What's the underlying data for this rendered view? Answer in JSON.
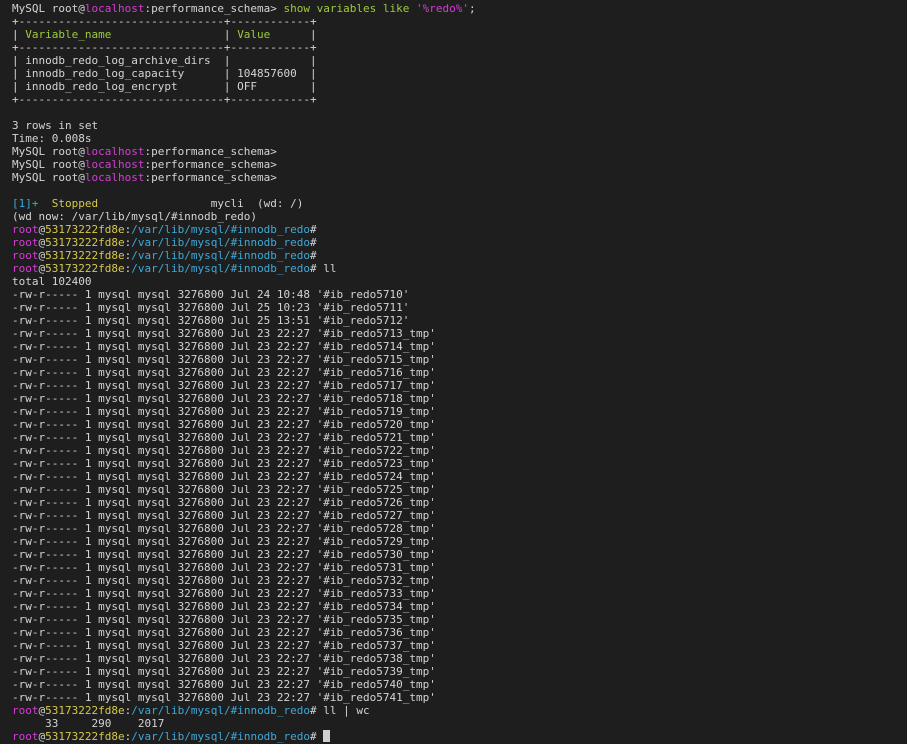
{
  "lines": [
    [
      {
        "t": "MySQL root@",
        "c": "wht"
      },
      {
        "t": "localhost",
        "c": "mag"
      },
      {
        "t": ":performance_schema> ",
        "c": "wht"
      },
      {
        "t": "show variables like ",
        "c": "grn"
      },
      {
        "t": "'%redo%'",
        "c": "mag"
      },
      {
        "t": ";",
        "c": "wht"
      }
    ],
    [
      {
        "t": "+-------------------------------+------------+",
        "c": "wht"
      }
    ],
    [
      {
        "t": "| ",
        "c": "wht"
      },
      {
        "t": "Variable_name",
        "c": "grn"
      },
      {
        "t": "                 | ",
        "c": "wht"
      },
      {
        "t": "Value",
        "c": "grn"
      },
      {
        "t": "      |",
        "c": "wht"
      }
    ],
    [
      {
        "t": "+-------------------------------+------------+",
        "c": "wht"
      }
    ],
    [
      {
        "t": "| innodb_redo_log_archive_dirs  |            |",
        "c": "wht"
      }
    ],
    [
      {
        "t": "| innodb_redo_log_capacity      | 104857600  |",
        "c": "wht"
      }
    ],
    [
      {
        "t": "| innodb_redo_log_encrypt       | OFF        |",
        "c": "wht"
      }
    ],
    [
      {
        "t": "+-------------------------------+------------+",
        "c": "wht"
      }
    ],
    [],
    [
      {
        "t": "3 rows in set",
        "c": "wht"
      }
    ],
    [
      {
        "t": "Time: 0.008s",
        "c": "wht"
      }
    ],
    [
      {
        "t": "MySQL root@",
        "c": "wht"
      },
      {
        "t": "localhost",
        "c": "mag"
      },
      {
        "t": ":performance_schema>",
        "c": "wht"
      }
    ],
    [
      {
        "t": "MySQL root@",
        "c": "wht"
      },
      {
        "t": "localhost",
        "c": "mag"
      },
      {
        "t": ":performance_schema>",
        "c": "wht"
      }
    ],
    [
      {
        "t": "MySQL root@",
        "c": "wht"
      },
      {
        "t": "localhost",
        "c": "mag"
      },
      {
        "t": ":performance_schema>",
        "c": "wht"
      }
    ],
    [],
    [
      {
        "t": "[1]+  ",
        "c": "cyn"
      },
      {
        "t": "Stopped",
        "c": "ylw"
      },
      {
        "t": "                 mycli  (wd: /)",
        "c": "wht"
      }
    ],
    [
      {
        "t": "(wd now: /var/lib/mysql/#innodb_redo)",
        "c": "wht"
      }
    ],
    [
      {
        "t": "root",
        "c": "mag"
      },
      {
        "t": "@",
        "c": "wht"
      },
      {
        "t": "53173222fd8e",
        "c": "ylw"
      },
      {
        "t": ":",
        "c": "wht"
      },
      {
        "t": "/var/lib/mysql/#innodb_redo",
        "c": "cyn"
      },
      {
        "t": "#",
        "c": "wht"
      }
    ],
    [
      {
        "t": "root",
        "c": "mag"
      },
      {
        "t": "@",
        "c": "wht"
      },
      {
        "t": "53173222fd8e",
        "c": "ylw"
      },
      {
        "t": ":",
        "c": "wht"
      },
      {
        "t": "/var/lib/mysql/#innodb_redo",
        "c": "cyn"
      },
      {
        "t": "#",
        "c": "wht"
      }
    ],
    [
      {
        "t": "root",
        "c": "mag"
      },
      {
        "t": "@",
        "c": "wht"
      },
      {
        "t": "53173222fd8e",
        "c": "ylw"
      },
      {
        "t": ":",
        "c": "wht"
      },
      {
        "t": "/var/lib/mysql/#innodb_redo",
        "c": "cyn"
      },
      {
        "t": "#",
        "c": "wht"
      }
    ],
    [
      {
        "t": "root",
        "c": "mag"
      },
      {
        "t": "@",
        "c": "wht"
      },
      {
        "t": "53173222fd8e",
        "c": "ylw"
      },
      {
        "t": ":",
        "c": "wht"
      },
      {
        "t": "/var/lib/mysql/#innodb_redo",
        "c": "cyn"
      },
      {
        "t": "# ll",
        "c": "wht"
      }
    ],
    [
      {
        "t": "total 102400",
        "c": "wht"
      }
    ],
    [
      {
        "t": "-rw-r----- 1 mysql mysql 3276800 Jul 24 10:48 '#ib_redo5710'",
        "c": "wht"
      }
    ],
    [
      {
        "t": "-rw-r----- 1 mysql mysql 3276800 Jul 25 10:23 '#ib_redo5711'",
        "c": "wht"
      }
    ],
    [
      {
        "t": "-rw-r----- 1 mysql mysql 3276800 Jul 25 13:51 '#ib_redo5712'",
        "c": "wht"
      }
    ],
    [
      {
        "t": "-rw-r----- 1 mysql mysql 3276800 Jul 23 22:27 '#ib_redo5713_tmp'",
        "c": "wht"
      }
    ],
    [
      {
        "t": "-rw-r----- 1 mysql mysql 3276800 Jul 23 22:27 '#ib_redo5714_tmp'",
        "c": "wht"
      }
    ],
    [
      {
        "t": "-rw-r----- 1 mysql mysql 3276800 Jul 23 22:27 '#ib_redo5715_tmp'",
        "c": "wht"
      }
    ],
    [
      {
        "t": "-rw-r----- 1 mysql mysql 3276800 Jul 23 22:27 '#ib_redo5716_tmp'",
        "c": "wht"
      }
    ],
    [
      {
        "t": "-rw-r----- 1 mysql mysql 3276800 Jul 23 22:27 '#ib_redo5717_tmp'",
        "c": "wht"
      }
    ],
    [
      {
        "t": "-rw-r----- 1 mysql mysql 3276800 Jul 23 22:27 '#ib_redo5718_tmp'",
        "c": "wht"
      }
    ],
    [
      {
        "t": "-rw-r----- 1 mysql mysql 3276800 Jul 23 22:27 '#ib_redo5719_tmp'",
        "c": "wht"
      }
    ],
    [
      {
        "t": "-rw-r----- 1 mysql mysql 3276800 Jul 23 22:27 '#ib_redo5720_tmp'",
        "c": "wht"
      }
    ],
    [
      {
        "t": "-rw-r----- 1 mysql mysql 3276800 Jul 23 22:27 '#ib_redo5721_tmp'",
        "c": "wht"
      }
    ],
    [
      {
        "t": "-rw-r----- 1 mysql mysql 3276800 Jul 23 22:27 '#ib_redo5722_tmp'",
        "c": "wht"
      }
    ],
    [
      {
        "t": "-rw-r----- 1 mysql mysql 3276800 Jul 23 22:27 '#ib_redo5723_tmp'",
        "c": "wht"
      }
    ],
    [
      {
        "t": "-rw-r----- 1 mysql mysql 3276800 Jul 23 22:27 '#ib_redo5724_tmp'",
        "c": "wht"
      }
    ],
    [
      {
        "t": "-rw-r----- 1 mysql mysql 3276800 Jul 23 22:27 '#ib_redo5725_tmp'",
        "c": "wht"
      }
    ],
    [
      {
        "t": "-rw-r----- 1 mysql mysql 3276800 Jul 23 22:27 '#ib_redo5726_tmp'",
        "c": "wht"
      }
    ],
    [
      {
        "t": "-rw-r----- 1 mysql mysql 3276800 Jul 23 22:27 '#ib_redo5727_tmp'",
        "c": "wht"
      }
    ],
    [
      {
        "t": "-rw-r----- 1 mysql mysql 3276800 Jul 23 22:27 '#ib_redo5728_tmp'",
        "c": "wht"
      }
    ],
    [
      {
        "t": "-rw-r----- 1 mysql mysql 3276800 Jul 23 22:27 '#ib_redo5729_tmp'",
        "c": "wht"
      }
    ],
    [
      {
        "t": "-rw-r----- 1 mysql mysql 3276800 Jul 23 22:27 '#ib_redo5730_tmp'",
        "c": "wht"
      }
    ],
    [
      {
        "t": "-rw-r----- 1 mysql mysql 3276800 Jul 23 22:27 '#ib_redo5731_tmp'",
        "c": "wht"
      }
    ],
    [
      {
        "t": "-rw-r----- 1 mysql mysql 3276800 Jul 23 22:27 '#ib_redo5732_tmp'",
        "c": "wht"
      }
    ],
    [
      {
        "t": "-rw-r----- 1 mysql mysql 3276800 Jul 23 22:27 '#ib_redo5733_tmp'",
        "c": "wht"
      }
    ],
    [
      {
        "t": "-rw-r----- 1 mysql mysql 3276800 Jul 23 22:27 '#ib_redo5734_tmp'",
        "c": "wht"
      }
    ],
    [
      {
        "t": "-rw-r----- 1 mysql mysql 3276800 Jul 23 22:27 '#ib_redo5735_tmp'",
        "c": "wht"
      }
    ],
    [
      {
        "t": "-rw-r----- 1 mysql mysql 3276800 Jul 23 22:27 '#ib_redo5736_tmp'",
        "c": "wht"
      }
    ],
    [
      {
        "t": "-rw-r----- 1 mysql mysql 3276800 Jul 23 22:27 '#ib_redo5737_tmp'",
        "c": "wht"
      }
    ],
    [
      {
        "t": "-rw-r----- 1 mysql mysql 3276800 Jul 23 22:27 '#ib_redo5738_tmp'",
        "c": "wht"
      }
    ],
    [
      {
        "t": "-rw-r----- 1 mysql mysql 3276800 Jul 23 22:27 '#ib_redo5739_tmp'",
        "c": "wht"
      }
    ],
    [
      {
        "t": "-rw-r----- 1 mysql mysql 3276800 Jul 23 22:27 '#ib_redo5740_tmp'",
        "c": "wht"
      }
    ],
    [
      {
        "t": "-rw-r----- 1 mysql mysql 3276800 Jul 23 22:27 '#ib_redo5741_tmp'",
        "c": "wht"
      }
    ],
    [
      {
        "t": "root",
        "c": "mag"
      },
      {
        "t": "@",
        "c": "wht"
      },
      {
        "t": "53173222fd8e",
        "c": "ylw"
      },
      {
        "t": ":",
        "c": "wht"
      },
      {
        "t": "/var/lib/mysql/#innodb_redo",
        "c": "cyn"
      },
      {
        "t": "# ll | wc",
        "c": "wht"
      }
    ],
    [
      {
        "t": "     33     290    2017",
        "c": "wht"
      }
    ],
    [
      {
        "t": "root",
        "c": "mag"
      },
      {
        "t": "@",
        "c": "wht"
      },
      {
        "t": "53173222fd8e",
        "c": "ylw"
      },
      {
        "t": ":",
        "c": "wht"
      },
      {
        "t": "/var/lib/mysql/#innodb_redo",
        "c": "cyn"
      },
      {
        "t": "# ",
        "c": "wht"
      }
    ]
  ],
  "colors": {
    "background": "#1e1e1e",
    "foreground": "#d4d4d4",
    "magenta": "#d63dd6",
    "green": "#9ecb3c",
    "yellow": "#d7c94a",
    "cyan": "#3fa8d8"
  }
}
